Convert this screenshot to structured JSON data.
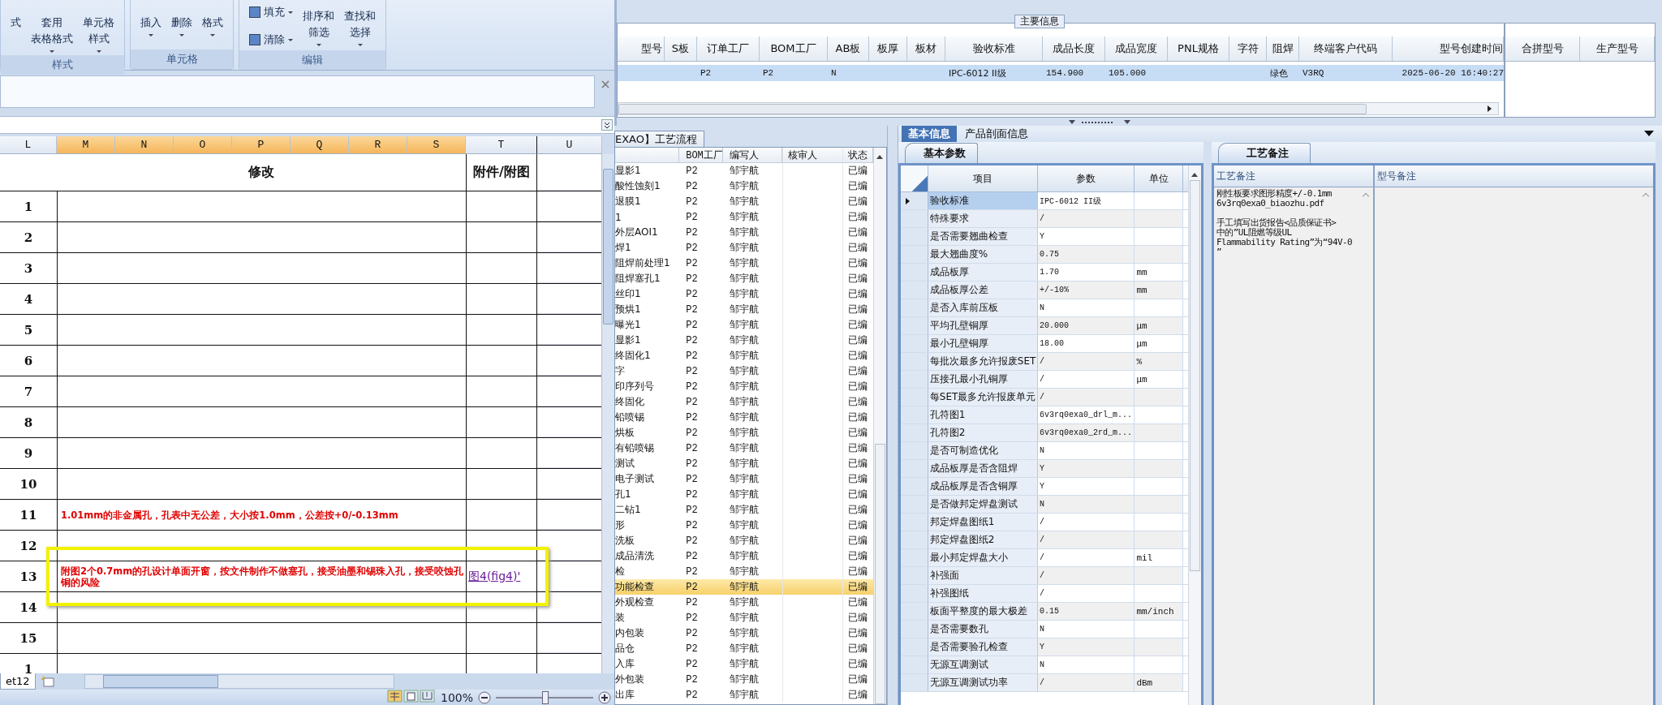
{
  "ribbon": {
    "groups": [
      {
        "label": "样式",
        "buttons": [
          {
            "kind": "large",
            "lines": [
              "式"
            ],
            "dropdown": false
          },
          {
            "kind": "large",
            "lines": [
              "套用",
              "表格格式"
            ],
            "dropdown": true
          },
          {
            "kind": "large",
            "lines": [
              "单元格",
              "样式"
            ],
            "dropdown": true
          }
        ]
      },
      {
        "label": "单元格",
        "buttons": [
          {
            "kind": "large",
            "lines": [
              "插入"
            ],
            "dropdown": true
          },
          {
            "kind": "large",
            "lines": [
              "删除"
            ],
            "dropdown": true
          },
          {
            "kind": "large",
            "lines": [
              "格式"
            ],
            "dropdown": true
          }
        ]
      },
      {
        "label": "编辑",
        "buttons": [
          {
            "kind": "small",
            "lines": [
              "填充"
            ],
            "dropdown": true
          },
          {
            "kind": "small",
            "lines": [
              "清除"
            ],
            "dropdown": true
          },
          {
            "kind": "large",
            "lines": [
              "排序和",
              "筛选"
            ],
            "dropdown": true
          },
          {
            "kind": "large",
            "lines": [
              "查找和",
              "选择"
            ],
            "dropdown": true
          }
        ]
      }
    ]
  },
  "sheet": {
    "columns": [
      {
        "label": "L",
        "selected": false
      },
      {
        "label": "M",
        "selected": true
      },
      {
        "label": "N",
        "selected": true
      },
      {
        "label": "O",
        "selected": true
      },
      {
        "label": "P",
        "selected": true
      },
      {
        "label": "Q",
        "selected": true
      },
      {
        "label": "R",
        "selected": true
      },
      {
        "label": "S",
        "selected": true
      },
      {
        "label": "T",
        "selected": false
      },
      {
        "label": "U",
        "selected": false
      }
    ],
    "title": "修改",
    "attachment_title": "附件/附图",
    "rows": [
      {
        "number": "1",
        "highlighted": false
      },
      {
        "number": "2",
        "highlighted": false
      },
      {
        "number": "3",
        "highlighted": false
      },
      {
        "number": "4",
        "highlighted": false
      },
      {
        "number": "5",
        "highlighted": false
      },
      {
        "number": "6",
        "highlighted": false
      },
      {
        "number": "7",
        "highlighted": false
      },
      {
        "number": "8",
        "highlighted": false
      },
      {
        "number": "9",
        "highlighted": false
      },
      {
        "number": "10",
        "highlighted": false
      },
      {
        "number": "11",
        "text": "1.01mm的非金属孔，孔表中无公差，大小按1.0mm，公差按+0/-0.13mm",
        "highlighted": false
      },
      {
        "number": "12",
        "highlighted": false
      },
      {
        "number": "13",
        "text": "附图2个0.7mm的孔设计单面开窗，按文件制作不做塞孔，接受油墨和锡珠入孔，接受咬蚀孔铜的风险",
        "link": "图4(fig4)'",
        "highlighted": true
      },
      {
        "number": "14",
        "highlighted": false
      },
      {
        "number": "15",
        "highlighted": false
      },
      {
        "number": "1",
        "highlighted": false
      }
    ],
    "tabs": [
      {
        "label": "et12",
        "selected": true
      }
    ]
  },
  "status_bar": {
    "zoom": "100%",
    "level": 0.5
  },
  "main_info": {
    "title": "主要信息",
    "columns": [
      "型号",
      "S板",
      "订单工厂",
      "BOM工厂",
      "AB板",
      "板厚",
      "板材",
      "验收标准",
      "成品长度",
      "成品宽度",
      "PNL规格",
      "字符",
      "阻焊",
      "终端客户代码",
      "型号创建时间"
    ],
    "rows": [
      {
        "selected": true,
        "cells": [
          null,
          null,
          "P2",
          "P2",
          "N",
          null,
          null,
          "IPC-6012 II级",
          "154.900",
          "105.000",
          null,
          null,
          "绿色",
          "V3RQ",
          "2025-06-20 16:40:27"
        ]
      }
    ],
    "merge_columns": [
      "合拼型号",
      "生产型号"
    ]
  },
  "process": {
    "tab": "EXAO】工艺流程",
    "columns": [
      "BOM工厂",
      "编写人",
      "核审人",
      "状态"
    ],
    "rows": [
      {
        "step": "显影1",
        "bom": "P2",
        "writer": "邹宇航",
        "status": "已编",
        "selected": false
      },
      {
        "step": "酸性蚀刻1",
        "bom": "P2",
        "writer": "邹宇航",
        "status": "已编",
        "selected": false
      },
      {
        "step": "退膜1",
        "bom": "P2",
        "writer": "邹宇航",
        "status": "已编",
        "selected": false
      },
      {
        "step": "1",
        "bom": "P2",
        "writer": "邹宇航",
        "status": "已编",
        "selected": false
      },
      {
        "step": "外层AOI1",
        "bom": "P2",
        "writer": "邹宇航",
        "status": "已编",
        "selected": false
      },
      {
        "step": "焊1",
        "bom": "P2",
        "writer": "邹宇航",
        "status": "已编",
        "selected": false
      },
      {
        "step": "阻焊前处理1",
        "bom": "P2",
        "writer": "邹宇航",
        "status": "已编",
        "selected": false
      },
      {
        "step": "阻焊塞孔1",
        "bom": "P2",
        "writer": "邹宇航",
        "status": "已编",
        "selected": false
      },
      {
        "step": "丝印1",
        "bom": "P2",
        "writer": "邹宇航",
        "status": "已编",
        "selected": false
      },
      {
        "step": "预烘1",
        "bom": "P2",
        "writer": "邹宇航",
        "status": "已编",
        "selected": false
      },
      {
        "step": "曝光1",
        "bom": "P2",
        "writer": "邹宇航",
        "status": "已编",
        "selected": false
      },
      {
        "step": "显影1",
        "bom": "P2",
        "writer": "邹宇航",
        "status": "已编",
        "selected": false
      },
      {
        "step": "终固化1",
        "bom": "P2",
        "writer": "邹宇航",
        "status": "已编",
        "selected": false
      },
      {
        "step": "字",
        "bom": "P2",
        "writer": "邹宇航",
        "status": "已编",
        "selected": false
      },
      {
        "step": "印序列号",
        "bom": "P2",
        "writer": "邹宇航",
        "status": "已编",
        "selected": false
      },
      {
        "step": "终固化",
        "bom": "P2",
        "writer": "邹宇航",
        "status": "已编",
        "selected": false
      },
      {
        "step": "铅喷锡",
        "bom": "P2",
        "writer": "邹宇航",
        "status": "已编",
        "selected": false
      },
      {
        "step": "烘板",
        "bom": "P2",
        "writer": "邹宇航",
        "status": "已编",
        "selected": false
      },
      {
        "step": "有铅喷锡",
        "bom": "P2",
        "writer": "邹宇航",
        "status": "已编",
        "selected": false
      },
      {
        "step": "测试",
        "bom": "P2",
        "writer": "邹宇航",
        "status": "已编",
        "selected": false
      },
      {
        "step": "电子测试",
        "bom": "P2",
        "writer": "邹宇航",
        "status": "已编",
        "selected": false
      },
      {
        "step": "孔1",
        "bom": "P2",
        "writer": "邹宇航",
        "status": "已编",
        "selected": false
      },
      {
        "step": "二钻1",
        "bom": "P2",
        "writer": "邹宇航",
        "status": "已编",
        "selected": false
      },
      {
        "step": "形",
        "bom": "P2",
        "writer": "邹宇航",
        "status": "已编",
        "selected": false
      },
      {
        "step": "洗板",
        "bom": "P2",
        "writer": "邹宇航",
        "status": "已编",
        "selected": false
      },
      {
        "step": "成品清洗",
        "bom": "P2",
        "writer": "邹宇航",
        "status": "已编",
        "selected": false
      },
      {
        "step": "检",
        "bom": "P2",
        "writer": "邹宇航",
        "status": "已编",
        "selected": false
      },
      {
        "step": "功能检查",
        "bom": "P2",
        "writer": "邹宇航",
        "status": "已编",
        "selected": true
      },
      {
        "step": "外观检查",
        "bom": "P2",
        "writer": "邹宇航",
        "status": "已编",
        "selected": false
      },
      {
        "step": "装",
        "bom": "P2",
        "writer": "邹宇航",
        "status": "已编",
        "selected": false
      },
      {
        "step": "内包装",
        "bom": "P2",
        "writer": "邹宇航",
        "status": "已编",
        "selected": false
      },
      {
        "step": "品仓",
        "bom": "P2",
        "writer": "邹宇航",
        "status": "已编",
        "selected": false
      },
      {
        "step": "入库",
        "bom": "P2",
        "writer": "邹宇航",
        "status": "已编",
        "selected": false
      },
      {
        "step": "外包装",
        "bom": "P2",
        "writer": "邹宇航",
        "status": "已编",
        "selected": false
      },
      {
        "step": "出库",
        "bom": "P2",
        "writer": "邹宇航",
        "status": "已编",
        "selected": false
      }
    ]
  },
  "basic": {
    "tabs": [
      {
        "label": "基本信息",
        "selected": true
      },
      {
        "label": "产品剖面信息",
        "selected": false
      }
    ],
    "subtab": "基本参数",
    "columns": [
      "项目",
      "参数",
      "单位"
    ],
    "rows": [
      {
        "item": "验收标准",
        "value": "IPC-6012 II级",
        "current": true
      },
      {
        "item": "特殊要求",
        "value": "/",
        "current": false
      },
      {
        "item": "是否需要翘曲检查",
        "value": "Y",
        "current": false
      },
      {
        "item": "最大翘曲度%",
        "value": "0.75",
        "current": false
      },
      {
        "item": "成品板厚",
        "value": "1.70",
        "unit": "mm",
        "current": false
      },
      {
        "item": "成品板厚公差",
        "value": "+/-10%",
        "unit": "mm",
        "current": false
      },
      {
        "item": "是否入库前压板",
        "value": "N",
        "current": false
      },
      {
        "item": "平均孔壁铜厚",
        "value": "20.000",
        "unit": "μm",
        "current": false
      },
      {
        "item": "最小孔壁铜厚",
        "value": "18.00",
        "unit": "μm",
        "current": false
      },
      {
        "item": "每批次最多允许报废SET",
        "value": "/",
        "unit": "%",
        "current": false
      },
      {
        "item": "压接孔最小孔铜厚",
        "value": "/",
        "unit": "μm",
        "current": false
      },
      {
        "item": "每SET最多允许报废单元",
        "value": "/",
        "current": false
      },
      {
        "item": "孔符图1",
        "value": "6v3rq0exa0_drl_m...",
        "current": false
      },
      {
        "item": "孔符图2",
        "value": "6v3rq0exa0_2rd_m...",
        "current": false
      },
      {
        "item": "是否可制造优化",
        "value": "N",
        "current": false
      },
      {
        "item": "成品板厚是否含阻焊",
        "value": "Y",
        "current": false
      },
      {
        "item": "成品板厚是否含铜厚",
        "value": "Y",
        "current": false
      },
      {
        "item": "是否做邦定焊盘测试",
        "value": "N",
        "current": false
      },
      {
        "item": "邦定焊盘图纸1",
        "value": "/",
        "current": false
      },
      {
        "item": "邦定焊盘图纸2",
        "value": "/",
        "current": false
      },
      {
        "item": "最小邦定焊盘大小",
        "value": "/",
        "unit": "mil",
        "current": false
      },
      {
        "item": "补强面",
        "value": "/",
        "current": false
      },
      {
        "item": "补强图纸",
        "value": "/",
        "current": false
      },
      {
        "item": "板面平整度的最大极差",
        "value": "0.15",
        "unit": "mm/inch",
        "current": false
      },
      {
        "item": "是否需要数孔",
        "value": "N",
        "current": false
      },
      {
        "item": "是否需要验孔检查",
        "value": "Y",
        "current": false
      },
      {
        "item": "无源互调测试",
        "value": "N",
        "current": false
      },
      {
        "item": "无源互调测试功率",
        "value": "/",
        "unit": "dBm",
        "current": false
      }
    ]
  },
  "notes": {
    "tab": "工艺备注",
    "columns": [
      "工艺备注",
      "型号备注"
    ],
    "process_note": "刚性板要求图形精度+/-0.1mm\n6v3rq0exa0_biaozhu.pdf\n\n手工填写出货报告<品质保证书>\n中的”UL阻燃等级UL\nFlammability Rating”为“94V-0\n”"
  }
}
